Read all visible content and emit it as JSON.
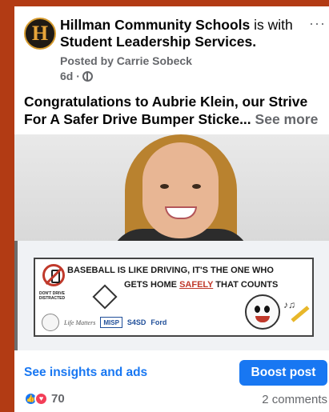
{
  "post": {
    "page_name": "Hillman Community Schools",
    "connector": "is with",
    "tagged": "Student Leadership Services.",
    "posted_by": "Posted by Carrie Sobeck",
    "age": "6d ·",
    "more_icon": "···",
    "avatar_letter": "H",
    "text": "Congratulations to Aubrie Klein, our Strive For A Safer Drive Bumper Sticke...",
    "see_more": "See more"
  },
  "sticker": {
    "line1": "BASEBALL IS LIKE DRIVING, IT'S THE ONE WHO",
    "line2_pre": "GETS HOME ",
    "line2_em": "SAFELY",
    "line2_post": " THAT COUNTS",
    "dont_drive": "DON'T DRIVE DISTRACTED",
    "sponsor_1": "Life Matters",
    "sponsor_2": "MISP",
    "sponsor_3": "S4SD",
    "sponsor_4": "Ford"
  },
  "actions": {
    "insights": "See insights and ads",
    "boost": "Boost post"
  },
  "footer": {
    "reaction_count": "70",
    "comments": "2 comments"
  }
}
